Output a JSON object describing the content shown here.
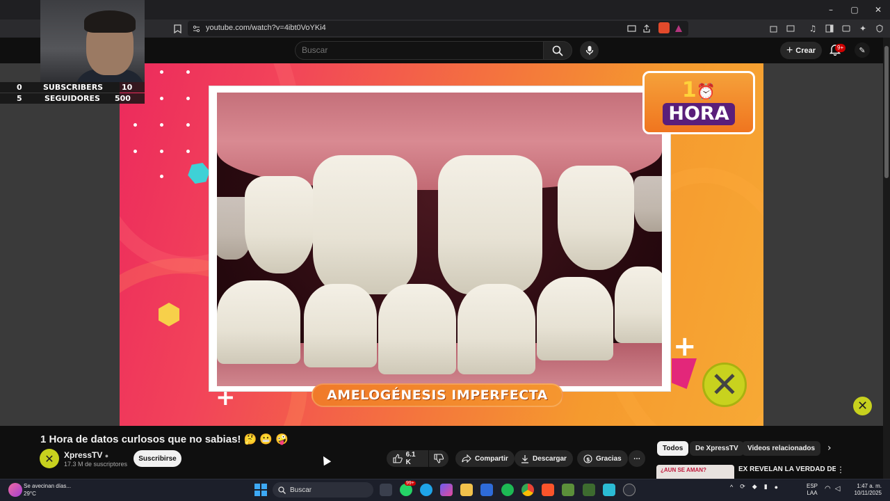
{
  "browser": {
    "url": "youtube.com/watch?v=4ibt0VoYKi4",
    "window_controls": [
      "–",
      "▢",
      "✕"
    ]
  },
  "header": {
    "search_placeholder": "Buscar",
    "create_label": "Crear",
    "notification_count": "9+"
  },
  "webcam_overlay": {
    "rows": [
      {
        "left": "0",
        "label": "SUBSCRIBERS",
        "right": "10"
      },
      {
        "left": "5",
        "label": "SEGUIDORES",
        "right": "500"
      }
    ]
  },
  "video": {
    "caption": "AMELOGÉNESIS IMPERFECTA",
    "badge_number": "1",
    "badge_text": "HORA"
  },
  "meta": {
    "title": "1 Hora de datos curlosos que no sabias! 🤔 😬 🤪",
    "channel_name": "XpressTV",
    "channel_subs": "17.3 M de suscriptores",
    "subscribe_label": "Suscribirse",
    "like_count": "6.1 K",
    "share_label": "Compartir",
    "download_label": "Descargar",
    "thanks_label": "Gracias"
  },
  "recommendations": {
    "chips": [
      "Todos",
      "De XpressTV",
      "Videos relacionados"
    ],
    "first_thumb_text": "¿AUN SE AMAN?",
    "first_title": "EX REVELAN LA VERDAD DE SU RELACIÓN"
  },
  "taskbar": {
    "weather_line1": "Se avecinan días...",
    "weather_line2": "29°C",
    "search_label": "Buscar",
    "whatsapp_badge": "99+",
    "lang_line1": "ESP",
    "lang_line2": "LAA",
    "time": "1:47 a. m.",
    "date": "10/11/2025"
  },
  "colors": {
    "accent_red": "#cc0000",
    "brand_lime": "#c7d11e",
    "video_pink": "#ec2a5c",
    "video_orange": "#f59a2e"
  }
}
